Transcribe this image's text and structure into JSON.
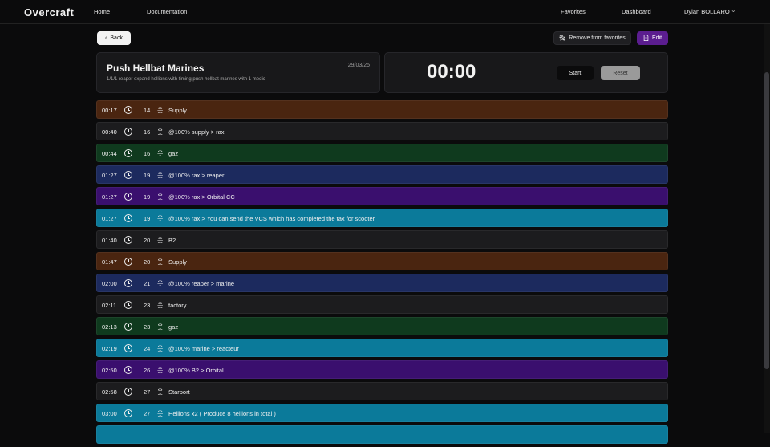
{
  "nav": {
    "brand": "Overcraft",
    "home": "Home",
    "documentation": "Documentation",
    "favorites": "Favorites",
    "dashboard": "Dashboard",
    "user": "Dylan BOLLARO"
  },
  "actions": {
    "back": "Back",
    "remove_favorites": "Remove from favorites",
    "edit": "Edit"
  },
  "build": {
    "title": "Push Hellbat Marines",
    "date": "29/03/25",
    "description": "1/1/1 reaper expand hellions with timing push hellbat marines with 1 medic"
  },
  "timer": {
    "display": "00:00",
    "start": "Start",
    "reset": "Reset"
  },
  "colors": {
    "supply": "#4a2510",
    "neutral": "#1c1c1e",
    "gas": "#0f3a1e",
    "blue": "#1c2a5e",
    "purple": "#3a0f6e",
    "cyan": "#0b7a9a"
  },
  "steps": [
    {
      "time": "00:17",
      "supply": "14",
      "text": "Supply",
      "color": "#4a2510"
    },
    {
      "time": "00:40",
      "supply": "16",
      "text": "@100% supply > rax",
      "color": "#1c1c1e"
    },
    {
      "time": "00:44",
      "supply": "16",
      "text": "gaz",
      "color": "#0f3a1e"
    },
    {
      "time": "01:27",
      "supply": "19",
      "text": "@100% rax > reaper",
      "color": "#1c2a5e"
    },
    {
      "time": "01:27",
      "supply": "19",
      "text": "@100% rax > Orbital CC",
      "color": "#3a0f6e"
    },
    {
      "time": "01:27",
      "supply": "19",
      "text": "@100% rax > You can send the VCS which has completed the tax for scooter",
      "color": "#0b7a9a"
    },
    {
      "time": "01:40",
      "supply": "20",
      "text": "B2",
      "color": "#1c1c1e"
    },
    {
      "time": "01:47",
      "supply": "20",
      "text": "Supply",
      "color": "#4a2510"
    },
    {
      "time": "02:00",
      "supply": "21",
      "text": "@100% reaper > marine",
      "color": "#1c2a5e"
    },
    {
      "time": "02:11",
      "supply": "23",
      "text": "factory",
      "color": "#1c1c1e"
    },
    {
      "time": "02:13",
      "supply": "23",
      "text": "gaz",
      "color": "#0f3a1e"
    },
    {
      "time": "02:19",
      "supply": "24",
      "text": "@100% marine > reacteur",
      "color": "#0b7a9a"
    },
    {
      "time": "02:50",
      "supply": "26",
      "text": "@100% B2 > Orbital",
      "color": "#3a0f6e"
    },
    {
      "time": "02:58",
      "supply": "27",
      "text": "Starport",
      "color": "#1c1c1e"
    },
    {
      "time": "03:00",
      "supply": "27",
      "text": "Hellions x2 ( Produce 8 hellions in total )",
      "color": "#0b7a9a"
    },
    {
      "time": "",
      "supply": "",
      "text": "",
      "color": "#0b7a9a"
    }
  ],
  "icons": {
    "back": "chevron-left-icon",
    "unfavorite": "star-off-icon",
    "edit": "document-icon",
    "clock": "clock-icon",
    "supply": "person-icon",
    "user_menu": "chevron-down-icon"
  }
}
